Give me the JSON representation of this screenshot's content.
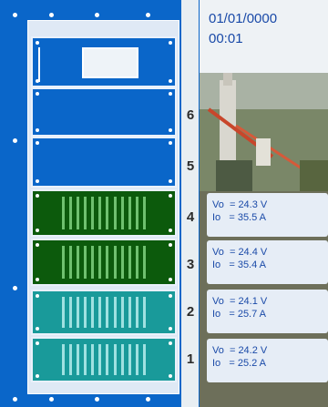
{
  "status": {
    "date": "01/01/0000",
    "time": "00:01"
  },
  "slot_labels": [
    "6",
    "5",
    "4",
    "3",
    "2",
    "1"
  ],
  "readings": [
    {
      "slot": "4",
      "vo": "Vo  = 24.3 V",
      "io": "Io   = 35.5 A"
    },
    {
      "slot": "3",
      "vo": "Vo  = 24.4 V",
      "io": "Io   = 35.4 A"
    },
    {
      "slot": "2",
      "vo": "Vo  = 24.1 V",
      "io": "Io   = 25.7 A"
    },
    {
      "slot": "1",
      "vo": "Vo  = 24.2 V",
      "io": "Io   = 25.2 A"
    }
  ],
  "colors": {
    "cabinet": "#0a66c9",
    "module_green": "#0c5a0c",
    "module_teal": "#199a9a",
    "text_blue": "#1a4aa8"
  },
  "icons": {
    "photo": "offshore-platform-photo"
  }
}
